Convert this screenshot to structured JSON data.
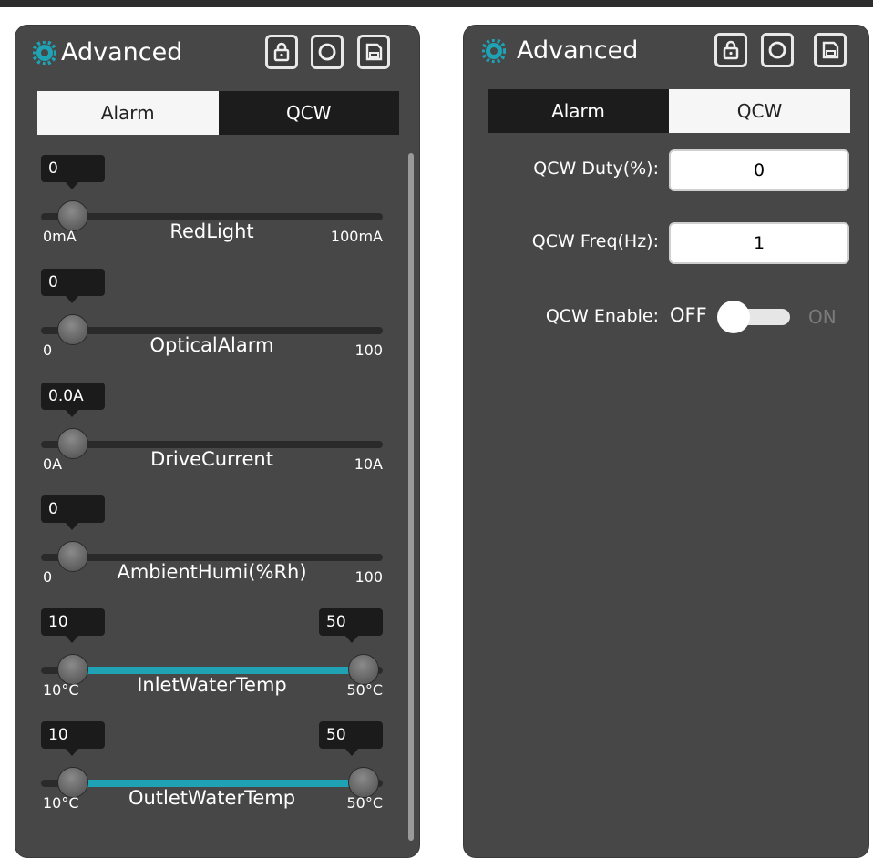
{
  "left_panel": {
    "title": "Advanced",
    "tabs": [
      {
        "label": "Alarm",
        "active": true
      },
      {
        "label": "QCW",
        "active": false
      }
    ],
    "sliders": [
      {
        "name": "RedLight",
        "min_label": "0mA",
        "max_label": "100mA",
        "value": "0",
        "fraction": 0
      },
      {
        "name": "OpticalAlarm",
        "min_label": "0",
        "max_label": "100",
        "value": "0",
        "fraction": 0
      },
      {
        "name": "DriveCurrent",
        "min_label": "0A",
        "max_label": "10A",
        "value": "0.0A",
        "fraction": 0
      },
      {
        "name": "AmbientHumi(%Rh)",
        "min_label": "0",
        "max_label": "100",
        "value": "0",
        "fraction": 0
      },
      {
        "name": "InletWaterTemp",
        "min_label": "10°C",
        "max_label": "50°C",
        "low": "10",
        "high": "50"
      },
      {
        "name": "OutletWaterTemp",
        "min_label": "10°C",
        "max_label": "50°C",
        "low": "10",
        "high": "50"
      }
    ]
  },
  "right_panel": {
    "title": "Advanced",
    "tabs": [
      {
        "label": "Alarm",
        "active": false
      },
      {
        "label": "QCW",
        "active": true
      }
    ],
    "fields": {
      "duty_label": "QCW Duty(%):",
      "duty_value": "0",
      "freq_label": "QCW Freq(Hz):",
      "freq_value": "1",
      "enable_label": "QCW Enable:",
      "off_label": "OFF",
      "on_label": "ON",
      "enabled": false
    }
  },
  "colors": {
    "panel": "#474747",
    "accent": "#1fa2b4",
    "tab_active": "#f6f6f6",
    "tab_inactive": "#1c1c1c"
  },
  "icons": [
    "gear-icon",
    "lock-icon",
    "refresh-icon",
    "save-icon"
  ]
}
